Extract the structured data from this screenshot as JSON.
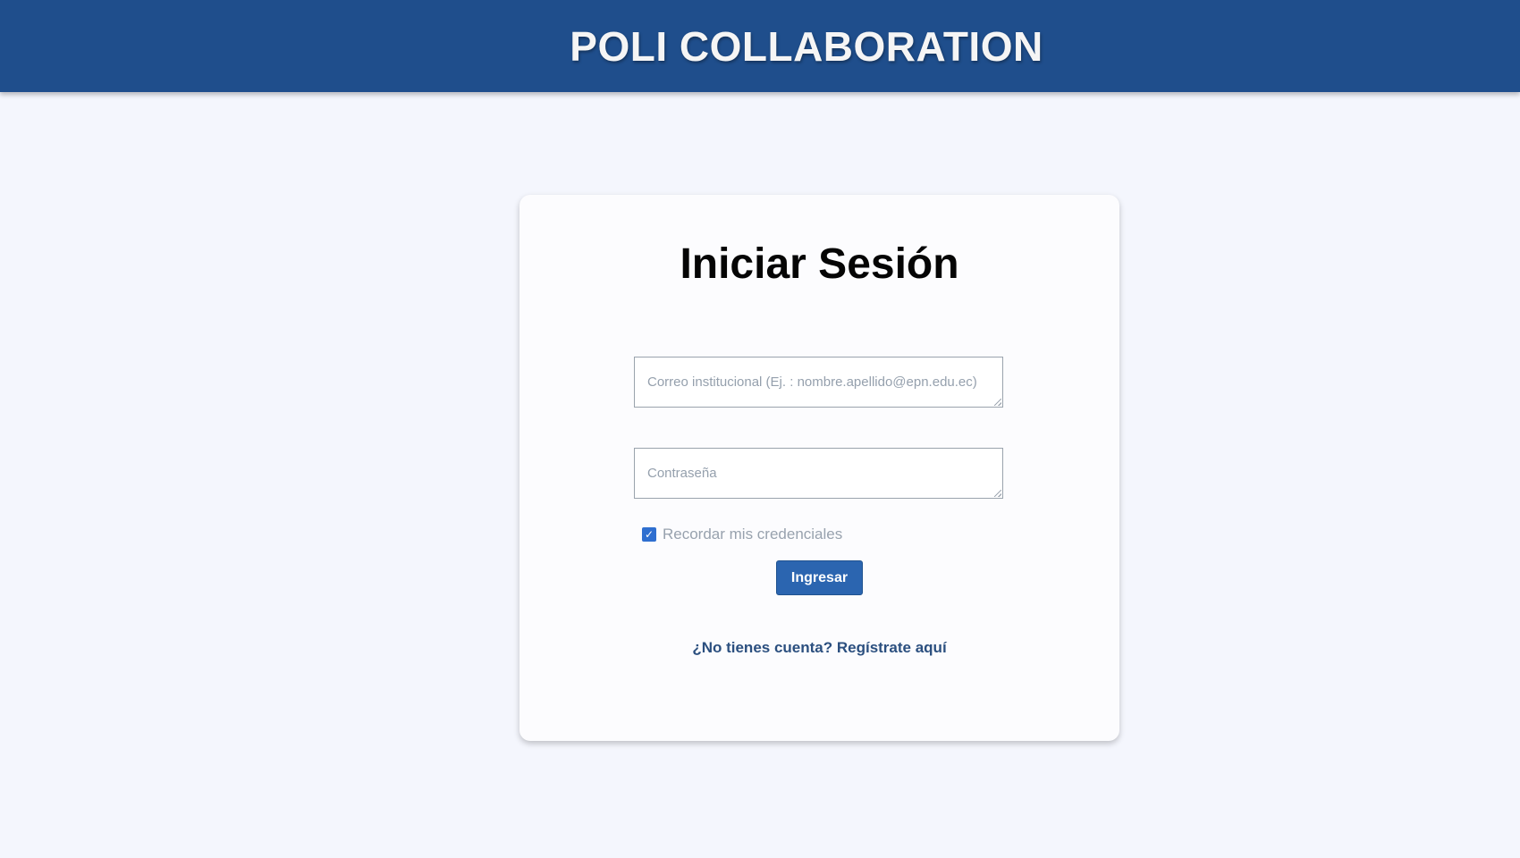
{
  "header": {
    "title": "POLI COLLABORATION"
  },
  "login": {
    "title": "Iniciar Sesión",
    "email_placeholder": "Correo institucional (Ej. : nombre.apellido@epn.edu.ec)",
    "password_placeholder": "Contraseña",
    "remember_label": "Recordar mis credenciales",
    "remember_checked": true,
    "submit_label": "Ingresar",
    "register_link": "¿No tienes cuenta? Regístrate aquí"
  },
  "colors": {
    "header_bg": "#1f4e8c",
    "page_bg": "#f4f6fd",
    "button_bg": "#2b65b0",
    "link": "#2b4f7f",
    "checkbox": "#2f6fd0"
  },
  "icons": {
    "checkbox_mark": "check-icon"
  }
}
